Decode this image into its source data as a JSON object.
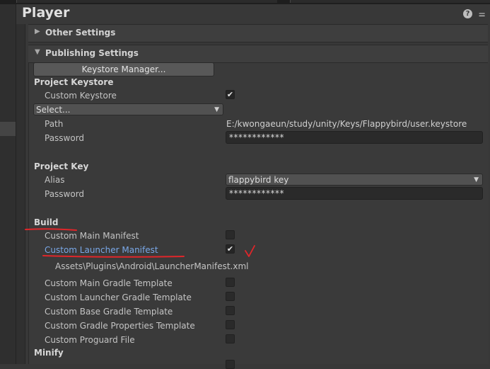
{
  "inspector": {
    "title": "Player",
    "help_icon": "help-icon",
    "settings_icon": "preset-settings-icon"
  },
  "other_settings": {
    "label": "Other Settings",
    "expanded": false
  },
  "publishing_settings": {
    "label": "Publishing Settings",
    "expanded": true,
    "keystore_manager_button": "Keystore Manager...",
    "project_keystore": {
      "heading": "Project Keystore",
      "custom_keystore_label": "Custom Keystore",
      "custom_keystore_checked": true,
      "select_dropdown": "Select...",
      "path_label": "Path",
      "path_value": "E:/kwongaeun/study/unity/Keys/Flappybird/user.keystore",
      "password_label": "Password",
      "password_value": "************"
    },
    "project_key": {
      "heading": "Project Key",
      "alias_label": "Alias",
      "alias_value": "flappybird key",
      "password_label": "Password",
      "password_value": "************"
    },
    "build": {
      "heading": "Build",
      "items": [
        {
          "label": "Custom Main Manifest",
          "checked": false
        },
        {
          "label": "Custom Launcher Manifest",
          "checked": true
        },
        {
          "label": "Custom Main Gradle Template",
          "checked": false
        },
        {
          "label": "Custom Launcher Gradle Template",
          "checked": false
        },
        {
          "label": "Custom Base Gradle Template",
          "checked": false
        },
        {
          "label": "Custom Gradle Properties Template",
          "checked": false
        },
        {
          "label": "Custom Proguard File",
          "checked": false
        }
      ],
      "launcher_manifest_path": "Assets\\Plugins\\Android\\LauncherManifest.xml"
    },
    "minify": {
      "heading": "Minify"
    }
  },
  "colors": {
    "background": "#383838",
    "field": "#2a2a2a",
    "link": "#7aa8e8",
    "annotation": "#e0262a"
  }
}
